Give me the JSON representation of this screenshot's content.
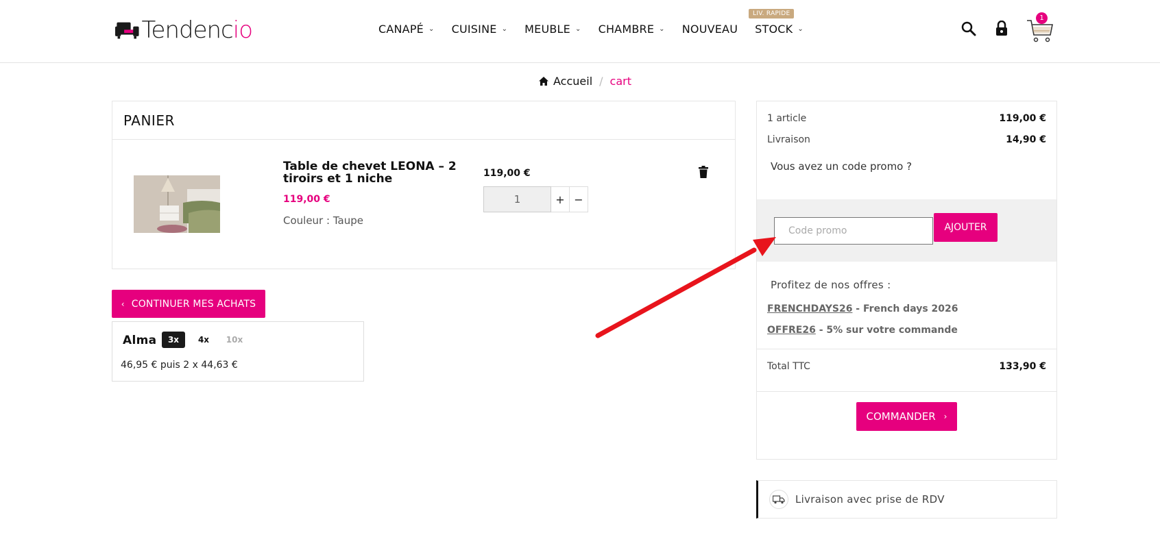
{
  "header": {
    "logo": {
      "text_dark": "Tendenc",
      "text_pink": "io"
    },
    "nav": [
      {
        "label": "CANAPÉ",
        "has_dropdown": true
      },
      {
        "label": "CUISINE",
        "has_dropdown": true
      },
      {
        "label": "MEUBLE",
        "has_dropdown": true
      },
      {
        "label": "CHAMBRE",
        "has_dropdown": true
      },
      {
        "label": "NOUVEAU",
        "has_dropdown": false
      },
      {
        "label": "STOCK",
        "has_dropdown": true
      }
    ],
    "stock_badge": "LIV. RAPIDE",
    "icons": [
      "search-icon",
      "lock-icon",
      "cart-icon"
    ],
    "cart_count": "1"
  },
  "breadcrumb": {
    "home": "Accueil",
    "separator": "/",
    "current": "cart"
  },
  "cart": {
    "title": "PANIER",
    "item": {
      "name": "Table de chevet LEONA – 2 tiroirs et 1 niche",
      "price": "119,00 €",
      "attribute": "Couleur : Taupe",
      "unit_price": "119,00 €",
      "quantity": "1",
      "plus": "+",
      "minus": "−"
    },
    "continue_label": "CONTINUER MES ACHATS"
  },
  "alma": {
    "brand": "Alma",
    "options": [
      "3x",
      "4x",
      "10x"
    ],
    "schedule": "46,95 € puis 2 x 44,63 €"
  },
  "summary": {
    "articles_label": "1 article",
    "articles_value": "119,00 €",
    "shipping_label": "Livraison",
    "shipping_value": "14,90 €",
    "promo_question": "Vous avez un code promo ?",
    "promo_placeholder": "Code promo",
    "promo_button": "AJOUTER",
    "offers_title": "Profitez de nos offres :",
    "offers": [
      {
        "code": "FRENCHDAYS26",
        "desc": " - French days 2026"
      },
      {
        "code": "OFFRE26",
        "desc": " - 5% sur votre commande"
      }
    ],
    "total_label": "Total TTC",
    "total_value": "133,90 €",
    "checkout_label": "COMMANDER"
  },
  "delivery": {
    "label": "Livraison avec prise de RDV"
  },
  "colors": {
    "brand": "#e6007e",
    "annotation_arrow": "#e8141c",
    "badge": "#c9a97f"
  }
}
